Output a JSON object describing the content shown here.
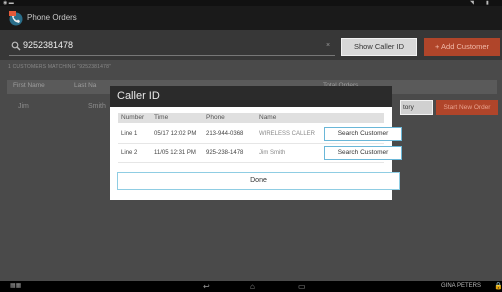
{
  "status": {
    "left_icon": "notification-icons",
    "right_icons": [
      "wifi-icon",
      "battery-icon"
    ]
  },
  "app": {
    "title": "Phone Orders"
  },
  "search": {
    "value": "9252381478",
    "clear": "×",
    "caller_id_label": "Show Caller ID",
    "add_customer_label": "+ Add Customer"
  },
  "matching_text": "1 CUSTOMERS MATCHING \"9252381478\"",
  "table": {
    "headers": [
      "First Name",
      "Last Na",
      "Total Orders"
    ],
    "row": {
      "first": "Jim",
      "last": "Smith",
      "history_label": "tory",
      "new_order_label": "Start New Order"
    }
  },
  "dialog": {
    "title": "Caller ID",
    "columns": [
      "Number",
      "Time",
      "Phone",
      "Name"
    ],
    "rows": [
      {
        "line": "Line 1",
        "time": "05/17 12:02 PM",
        "phone": "213-944-0368",
        "name": "WIRELESS CALLER",
        "button": "Search Customer"
      },
      {
        "line": "Line 2",
        "time": "11/05 12:31 PM",
        "phone": "925-238-1478",
        "name": "Jim Smith",
        "button": "Search Customer"
      }
    ],
    "done_label": "Done"
  },
  "navbar": {
    "user": "GINA PETERS"
  },
  "colors": {
    "accent": "#b0452a",
    "outline": "#6ab7d8"
  }
}
